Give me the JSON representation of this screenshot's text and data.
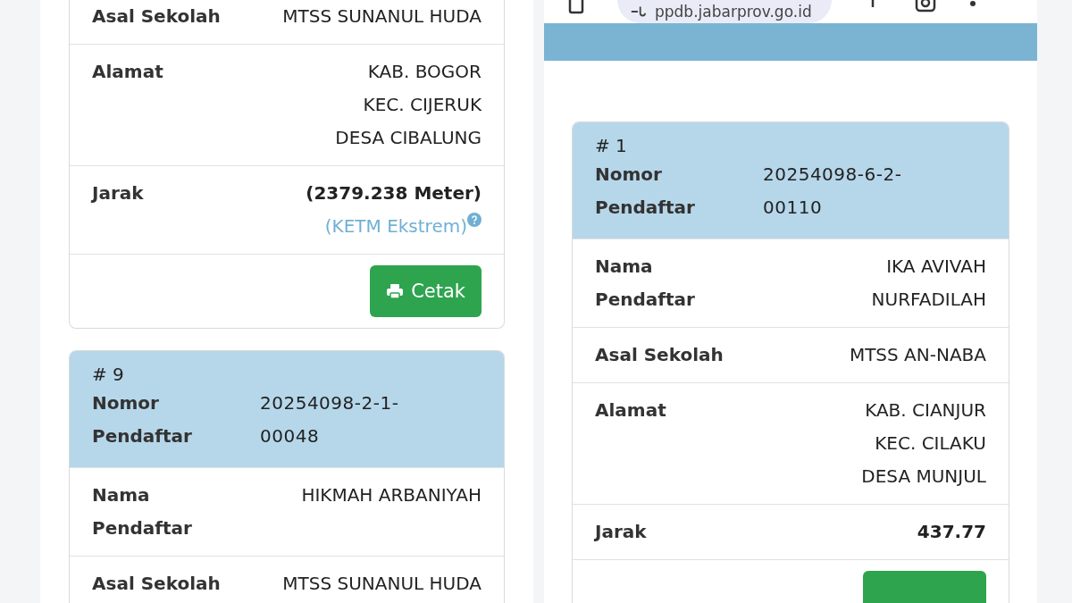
{
  "left": {
    "cards": [
      {
        "cut_top": true,
        "rows": [
          {
            "kind": "text",
            "label": "Asal Sekolah",
            "lines": [
              "MTSS SUNANUL HUDA"
            ]
          },
          {
            "kind": "text",
            "label": "Alamat",
            "lines": [
              "KAB. BOGOR",
              "KEC. CIJERUK",
              "DESA CIBALUNG"
            ]
          },
          {
            "kind": "distance",
            "label": "Jarak",
            "lines": [
              "(2379.238 Meter)"
            ],
            "note": "(KETM Ekstrem)",
            "help": true
          }
        ],
        "action": {
          "kind": "button",
          "label": "Cetak"
        }
      },
      {
        "cut_top": false,
        "header": {
          "number": "# 9",
          "label": "Nomor Pendaftar",
          "lines": [
            "20254098-2-1-",
            "00048"
          ]
        },
        "rows": [
          {
            "kind": "text",
            "label": "Nama Pendaftar",
            "lines": [
              "HIKMAH ARBANIYAH"
            ]
          },
          {
            "kind": "text",
            "label": "Asal Sekolah",
            "lines": [
              "MTSS SUNANUL HUDA"
            ]
          }
        ]
      }
    ]
  },
  "right": {
    "browser": {
      "url": "ppdb.jabarprov.go.id"
    },
    "cards": [
      {
        "cut_top": false,
        "header": {
          "number": "# 1",
          "label": "Nomor Pendaftar",
          "lines": [
            "20254098-6-2-",
            "00110"
          ]
        },
        "rows": [
          {
            "kind": "text",
            "label": "Nama Pendaftar",
            "lines": [
              "IKA AVIVAH",
              "NURFADILAH"
            ]
          },
          {
            "kind": "text",
            "label": "Asal Sekolah",
            "lines": [
              "MTSS AN-NABA"
            ]
          },
          {
            "kind": "text",
            "label": "Alamat",
            "lines": [
              "KAB. CIANJUR",
              "KEC. CILAKU",
              "DESA MUNJUL"
            ]
          },
          {
            "kind": "distance",
            "label": "Jarak",
            "lines": [
              "437.77"
            ]
          }
        ],
        "action": {
          "kind": "button"
        }
      }
    ]
  }
}
